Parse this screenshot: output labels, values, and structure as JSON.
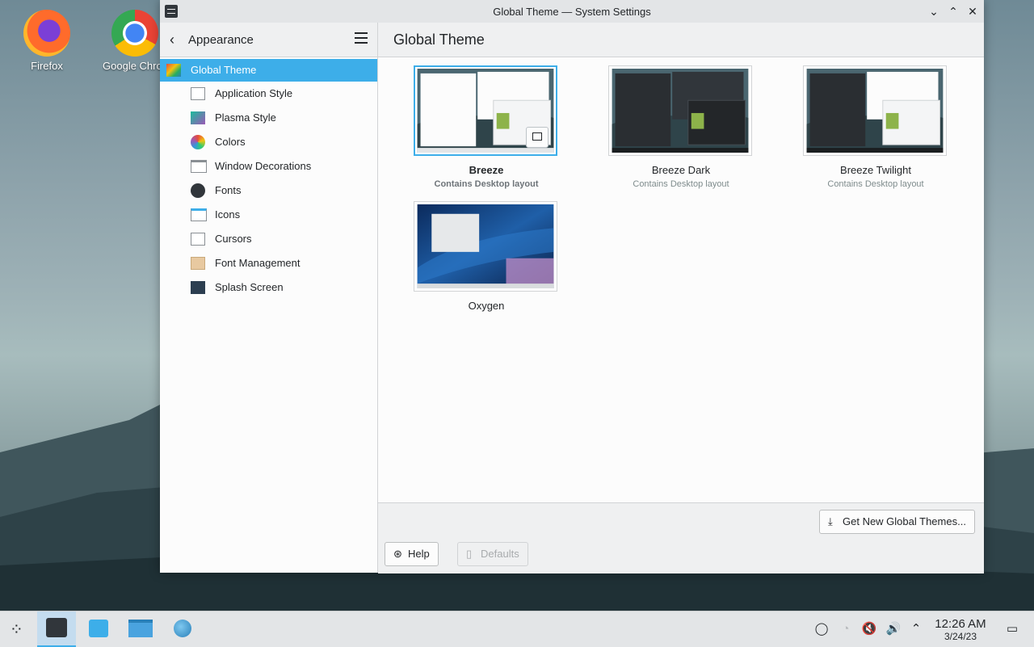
{
  "desktop": {
    "icons": [
      {
        "label": "Firefox"
      },
      {
        "label": "Google Chrome"
      }
    ]
  },
  "window": {
    "title": "Global Theme — System Settings",
    "controls": {
      "minimize": "⌄",
      "maximize": "⌃",
      "close": "✕"
    }
  },
  "sidebar": {
    "title": "Appearance",
    "items": [
      {
        "label": "Global Theme"
      },
      {
        "label": "Application Style"
      },
      {
        "label": "Plasma Style"
      },
      {
        "label": "Colors"
      },
      {
        "label": "Window Decorations"
      },
      {
        "label": "Fonts"
      },
      {
        "label": "Icons"
      },
      {
        "label": "Cursors"
      },
      {
        "label": "Font Management"
      },
      {
        "label": "Splash Screen"
      }
    ]
  },
  "main": {
    "title": "Global Theme",
    "themes": [
      {
        "name": "Breeze",
        "subtitle": "Contains Desktop layout"
      },
      {
        "name": "Breeze Dark",
        "subtitle": "Contains Desktop layout"
      },
      {
        "name": "Breeze Twilight",
        "subtitle": "Contains Desktop layout"
      },
      {
        "name": "Oxygen",
        "subtitle": ""
      }
    ],
    "get_new_label": "Get New Global Themes...",
    "help_label": "Help",
    "defaults_label": "Defaults"
  },
  "taskbar": {
    "time": "12:26 AM",
    "date": "3/24/23"
  },
  "colors": {
    "accent": "#3daee9",
    "window_bg": "#eff0f1",
    "view_bg": "#fcfcfc"
  }
}
